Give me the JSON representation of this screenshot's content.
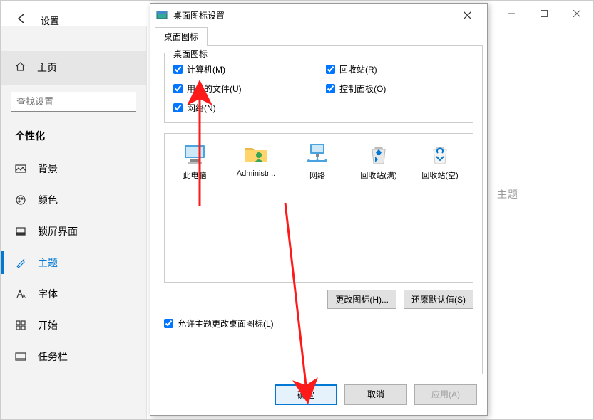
{
  "bgWindow": {
    "back": "",
    "settingsTitle": "设置",
    "homeLabel": "主页",
    "searchPlaceholder": "查找设置",
    "sectionLabel": "个性化",
    "nav": {
      "background": "背景",
      "color": "颜色",
      "lockscreen": "锁屏界面",
      "theme": "主题",
      "font": "字体",
      "start": "开始",
      "taskbar": "任务栏"
    },
    "rightPartial": "主题"
  },
  "dialog": {
    "title": "桌面图标设置",
    "tab": "桌面图标",
    "legend": "桌面图标",
    "checks": {
      "computer": "计算机(M)",
      "recycle": "回收站(R)",
      "userfiles": "用户的文件(U)",
      "control": "控制面板(O)",
      "network": "网络(N)"
    },
    "icons": {
      "thispc": "此电脑",
      "admin": "Administr...",
      "network": "网络",
      "recycleFull": "回收站(满)",
      "recycleEmpty": "回收站(空)"
    },
    "changeIcon": "更改图标(H)...",
    "restoreDefault": "还原默认值(S)",
    "allowThemes": "允许主题更改桌面图标(L)",
    "ok": "确定",
    "cancel": "取消",
    "apply": "应用(A)"
  }
}
